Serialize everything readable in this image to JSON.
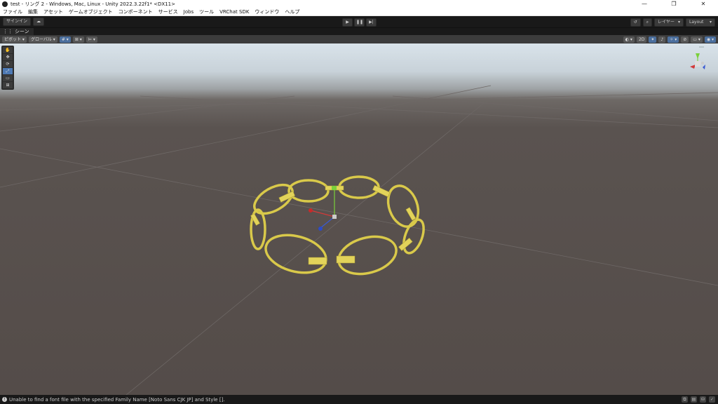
{
  "window": {
    "title": "test - リング 2 - Windows, Mac, Linux - Unity 2022.3.22f1* <DX11>",
    "controls": [
      "—",
      "❐",
      "✕"
    ]
  },
  "menu": [
    "ファイル",
    "編集",
    "アセット",
    "ゲームオブジェクト",
    "コンポーネント",
    "サービス",
    "Jobs",
    "ツール",
    "VRChat SDK",
    "ウィンドウ",
    "ヘルプ"
  ],
  "toolbar": {
    "signin": "サインイン",
    "layers_label": "レイヤー",
    "layout_label": "Layout"
  },
  "scene": {
    "tab_label": "シーン",
    "pivot_label": "ピボット",
    "global_label": "グローバル",
    "mode_2d": "2D"
  },
  "statusbar": {
    "message": "Unable to find a font file with the specified Family Name [Noto Sans CJK JP] and Style []."
  },
  "colors": {
    "ring": "#d9c94a",
    "sky": "#d9e3ea",
    "ground": "#554d4a",
    "accent": "#4d79b4"
  }
}
